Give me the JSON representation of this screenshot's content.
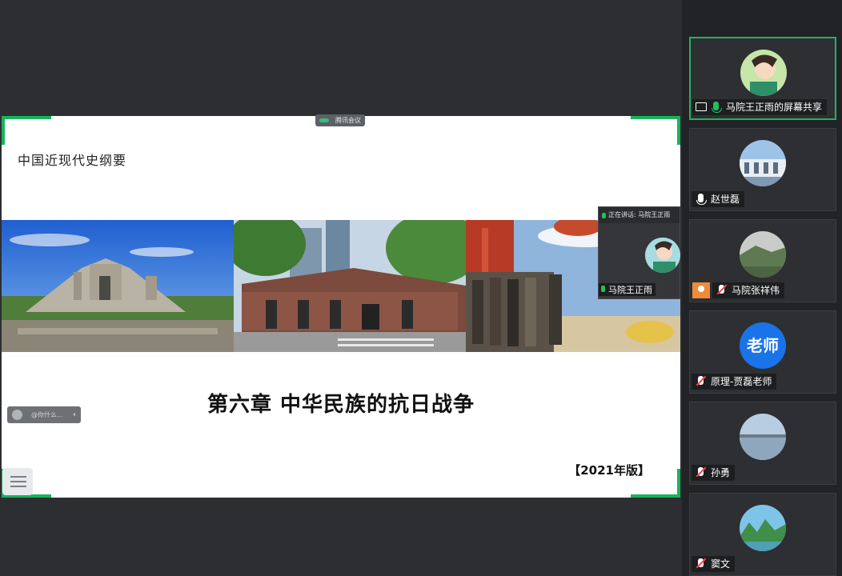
{
  "meeting_app_label": "腾讯会议",
  "slide": {
    "title": "中国近现代史纲要",
    "main_heading": "第六章  中华民族的抗日战争",
    "edition": "【2021年版】"
  },
  "hint_bar": {
    "text": "@你什么..."
  },
  "speaker_pip": {
    "header": "正在讲话: 马院王正雨",
    "name": "马院王正雨"
  },
  "participants": [
    {
      "name": "马院王正雨的屏幕共享",
      "status": "screen-share",
      "mic": "on",
      "avatar": "cartoon"
    },
    {
      "name": "赵世磊",
      "status": "normal",
      "mic": "on",
      "avatar": "building-photo"
    },
    {
      "name": "马院张祥伟",
      "status": "normal",
      "mic": "off",
      "avatar": "landscape-photo"
    },
    {
      "name": "原理-贾磊老师",
      "status": "normal",
      "mic": "off",
      "avatar": "text",
      "avatar_text": "老师"
    },
    {
      "name": "孙勇",
      "status": "normal",
      "mic": "off",
      "avatar": "lake-photo"
    },
    {
      "name": "窦文",
      "status": "normal",
      "mic": "off",
      "avatar": "mountain-photo"
    }
  ],
  "colors": {
    "accent": "#21b35e",
    "panel_bg": "#222326",
    "stage_bg": "#2d2e31",
    "muted": "#ff4040"
  }
}
